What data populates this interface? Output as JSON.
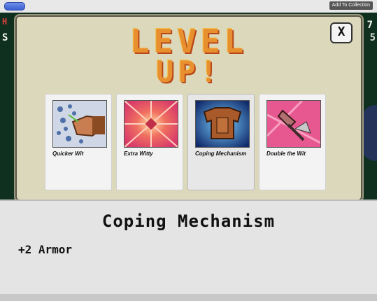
{
  "topbar": {
    "collect_label": "Add To Collection"
  },
  "hud": {
    "left_top": "H",
    "left_bottom": "S",
    "right_top": "7",
    "right_bottom": "5"
  },
  "dialog": {
    "title_line1": "LEVEL",
    "title_line2": "UP!",
    "close_label": "X",
    "cards": [
      {
        "name": "Quicker Wit",
        "icon": "fist-with-orbs"
      },
      {
        "name": "Extra Witty",
        "icon": "starburst"
      },
      {
        "name": "Coping Mechanism",
        "icon": "armor-chestplate"
      },
      {
        "name": "Double the Wit",
        "icon": "double-axe"
      }
    ],
    "selected_index": 2
  },
  "detail": {
    "name": "Coping Mechanism",
    "stat": "+2 Armor"
  }
}
